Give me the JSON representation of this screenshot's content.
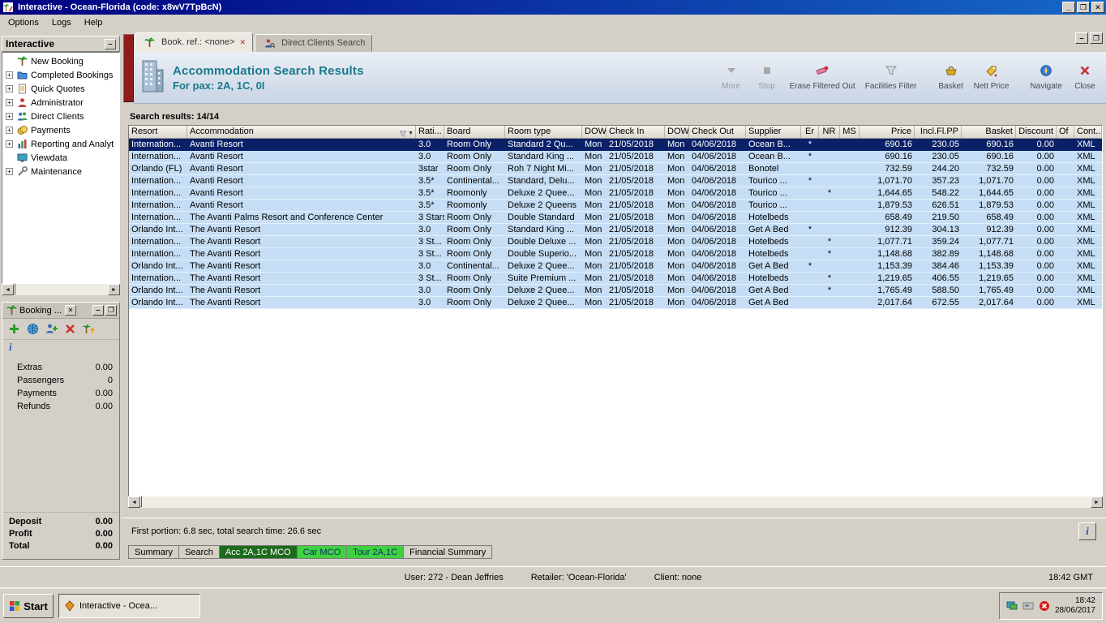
{
  "window": {
    "title": "Interactive - Ocean-Florida (code: x8wV7TpBcN)",
    "menu": [
      "Options",
      "Logs",
      "Help"
    ]
  },
  "colors": {
    "titlebar_blue": "#000080",
    "header_teal": "#19788c",
    "row_blue": "#c6def5",
    "selected_row_navy": "#0a2168",
    "tab_dark_green": "#1c6b1c",
    "tab_bright_green": "#3fd23f"
  },
  "sidebar": {
    "title": "Interactive",
    "items": [
      {
        "label": "New Booking",
        "icon": "palm",
        "expandable": false
      },
      {
        "label": "Completed Bookings",
        "icon": "folder",
        "expandable": true
      },
      {
        "label": "Quick Quotes",
        "icon": "doc",
        "expandable": true
      },
      {
        "label": "Administrator",
        "icon": "person",
        "expandable": true
      },
      {
        "label": "Direct Clients",
        "icon": "people",
        "expandable": true
      },
      {
        "label": "Payments",
        "icon": "money",
        "expandable": true
      },
      {
        "label": "Reporting and Analyt",
        "icon": "chart",
        "expandable": true
      },
      {
        "label": "Viewdata",
        "icon": "monitor",
        "expandable": false
      },
      {
        "label": "Maintenance",
        "icon": "wrench",
        "expandable": true
      }
    ]
  },
  "booking_panel": {
    "title": "Booking ...",
    "toolbar": [
      {
        "name": "add-booking",
        "icon": "addplus"
      },
      {
        "name": "refresh-world",
        "icon": "world"
      },
      {
        "name": "add-passenger",
        "icon": "addperson"
      },
      {
        "name": "delete",
        "icon": "delx"
      },
      {
        "name": "export-booking",
        "icon": "palmup"
      }
    ],
    "info_glyph": "i",
    "fields": [
      {
        "label": "Extras",
        "value": "0.00"
      },
      {
        "label": "Passengers",
        "value": "0"
      },
      {
        "label": "Payments",
        "value": "0.00"
      },
      {
        "label": "Refunds",
        "value": "0.00"
      }
    ],
    "totals": [
      {
        "label": "Deposit",
        "value": "0.00"
      },
      {
        "label": "Profit",
        "value": "0.00"
      },
      {
        "label": "Total",
        "value": "0.00"
      }
    ]
  },
  "main_tabs": [
    {
      "label": "Book. ref.: <none>",
      "icon": "palm",
      "closable": true,
      "active": true
    },
    {
      "label": "Direct Clients Search",
      "icon": "personsearch",
      "closable": false,
      "active": false
    }
  ],
  "header": {
    "title": "Accommodation Search Results",
    "subtitle": "For pax: 2A, 1C, 0I",
    "toolbar": [
      {
        "label": "More",
        "icon": "more",
        "enabled": false,
        "gap": false
      },
      {
        "label": "Stop",
        "icon": "stop",
        "enabled": false,
        "gap": false
      },
      {
        "label": "Erase Filtered Out",
        "icon": "eraser",
        "enabled": true,
        "gap": false
      },
      {
        "label": "Facilities Filter",
        "icon": "filter",
        "enabled": true,
        "gap": false
      },
      {
        "label": "Basket",
        "icon": "basket",
        "enabled": true,
        "gap": true
      },
      {
        "label": "Nett Price",
        "icon": "nettprice",
        "enabled": true,
        "gap": false
      },
      {
        "label": "Navigate",
        "icon": "navigate",
        "enabled": true,
        "gap": true
      },
      {
        "label": "Close",
        "icon": "closex",
        "enabled": true,
        "gap": false
      }
    ]
  },
  "results": {
    "summary": "Search results: 14/14",
    "selected_row": 0,
    "columns": [
      "Resort",
      "Accommodation",
      "Rati...",
      "Board",
      "Room type",
      "DOW",
      "Check In",
      "DOW",
      "Check Out",
      "Supplier",
      "Er",
      "NR",
      "MS",
      "Price",
      "Incl.Fl.PP",
      "Basket",
      "Discount",
      "Of",
      "Cont..."
    ],
    "rows": [
      [
        "Internation...",
        "Avanti Resort",
        "3.0",
        "Room Only",
        "Standard 2 Qu...",
        "Mon",
        "21/05/2018",
        "Mon",
        "04/06/2018",
        "Ocean B...",
        "*",
        "",
        "",
        "690.16",
        "230.05",
        "690.16",
        "0.00",
        "",
        "XML"
      ],
      [
        "Internation...",
        "Avanti Resort",
        "3.0",
        "Room Only",
        "Standard King ...",
        "Mon",
        "21/05/2018",
        "Mon",
        "04/06/2018",
        "Ocean B...",
        "*",
        "",
        "",
        "690.16",
        "230.05",
        "690.16",
        "0.00",
        "",
        "XML"
      ],
      [
        "Orlando (FL)",
        "Avanti Resort",
        "3star",
        "Room Only",
        "Roh 7 Night Mi...",
        "Mon",
        "21/05/2018",
        "Mon",
        "04/06/2018",
        "Bonotel",
        "",
        "",
        "",
        "732.59",
        "244.20",
        "732.59",
        "0.00",
        "",
        "XML"
      ],
      [
        "Internation...",
        "Avanti Resort",
        "3.5*",
        "Continental...",
        "Standard, Delu...",
        "Mon",
        "21/05/2018",
        "Mon",
        "04/06/2018",
        "Tourico ...",
        "*",
        "",
        "",
        "1,071.70",
        "357.23",
        "1,071.70",
        "0.00",
        "",
        "XML"
      ],
      [
        "Internation...",
        "Avanti Resort",
        "3.5*",
        "Roomonly",
        "Deluxe 2 Quee...",
        "Mon",
        "21/05/2018",
        "Mon",
        "04/06/2018",
        "Tourico ...",
        "",
        "*",
        "",
        "1,644.65",
        "548.22",
        "1,644.65",
        "0.00",
        "",
        "XML"
      ],
      [
        "Internation...",
        "Avanti Resort",
        "3.5*",
        "Roomonly",
        "Deluxe 2 Queens",
        "Mon",
        "21/05/2018",
        "Mon",
        "04/06/2018",
        "Tourico ...",
        "",
        "",
        "",
        "1,879.53",
        "626.51",
        "1,879.53",
        "0.00",
        "",
        "XML"
      ],
      [
        "Internation...",
        "The Avanti Palms Resort and Conference Center",
        "3 Stars",
        "Room Only",
        "Double Standard",
        "Mon",
        "21/05/2018",
        "Mon",
        "04/06/2018",
        "Hotelbeds",
        "",
        "",
        "",
        "658.49",
        "219.50",
        "658.49",
        "0.00",
        "",
        "XML"
      ],
      [
        "Orlando Int...",
        "The Avanti Resort",
        "3.0",
        "Room Only",
        "Standard King ...",
        "Mon",
        "21/05/2018",
        "Mon",
        "04/06/2018",
        "Get A Bed",
        "*",
        "",
        "",
        "912.39",
        "304.13",
        "912.39",
        "0.00",
        "",
        "XML"
      ],
      [
        "Internation...",
        "The Avanti Resort",
        "3 St...",
        "Room Only",
        "Double Deluxe ...",
        "Mon",
        "21/05/2018",
        "Mon",
        "04/06/2018",
        "Hotelbeds",
        "",
        "*",
        "",
        "1,077.71",
        "359.24",
        "1,077.71",
        "0.00",
        "",
        "XML"
      ],
      [
        "Internation...",
        "The Avanti Resort",
        "3 St...",
        "Room Only",
        "Double Superio...",
        "Mon",
        "21/05/2018",
        "Mon",
        "04/06/2018",
        "Hotelbeds",
        "",
        "*",
        "",
        "1,148.68",
        "382.89",
        "1,148.68",
        "0.00",
        "",
        "XML"
      ],
      [
        "Orlando Int...",
        "The Avanti Resort",
        "3.0",
        "Continental...",
        "Deluxe 2 Quee...",
        "Mon",
        "21/05/2018",
        "Mon",
        "04/06/2018",
        "Get A Bed",
        "*",
        "",
        "",
        "1,153.39",
        "384.46",
        "1,153.39",
        "0.00",
        "",
        "XML"
      ],
      [
        "Internation...",
        "The Avanti Resort",
        "3 St...",
        "Room Only",
        "Suite Premium ...",
        "Mon",
        "21/05/2018",
        "Mon",
        "04/06/2018",
        "Hotelbeds",
        "",
        "*",
        "",
        "1,219.65",
        "406.55",
        "1,219.65",
        "0.00",
        "",
        "XML"
      ],
      [
        "Orlando Int...",
        "The Avanti Resort",
        "3.0",
        "Room Only",
        "Deluxe 2 Quee...",
        "Mon",
        "21/05/2018",
        "Mon",
        "04/06/2018",
        "Get A Bed",
        "",
        "*",
        "",
        "1,765.49",
        "588.50",
        "1,765.49",
        "0.00",
        "",
        "XML"
      ],
      [
        "Orlando Int...",
        "The Avanti Resort",
        "3.0",
        "Room Only",
        "Deluxe 2 Quee...",
        "Mon",
        "21/05/2018",
        "Mon",
        "04/06/2018",
        "Get A Bed",
        "",
        "",
        "",
        "2,017.64",
        "672.55",
        "2,017.64",
        "0.00",
        "",
        "XML"
      ]
    ]
  },
  "footer": {
    "timing": "First portion: 6.8 sec, total search time: 26.6 sec",
    "tabs": [
      {
        "label": "Summary",
        "style": "plain"
      },
      {
        "label": "Search",
        "style": "plain"
      },
      {
        "label": "Acc 2A,1C MCO",
        "style": "dkgreen"
      },
      {
        "label": "Car MCO",
        "style": "green"
      },
      {
        "label": "Tour 2A,1C",
        "style": "green"
      },
      {
        "label": "Financial Summary",
        "style": "plain"
      }
    ]
  },
  "statusbar": {
    "user": "User: 272 - Dean Jeffries",
    "retailer": "Retailer: 'Ocean-Florida'",
    "client": "Client: none",
    "time": "18:42 GMT"
  },
  "taskbar": {
    "start_label": "Start",
    "task_label": "Interactive - Ocea...",
    "tray_time": "18:42",
    "tray_date": "28/06/2017"
  }
}
